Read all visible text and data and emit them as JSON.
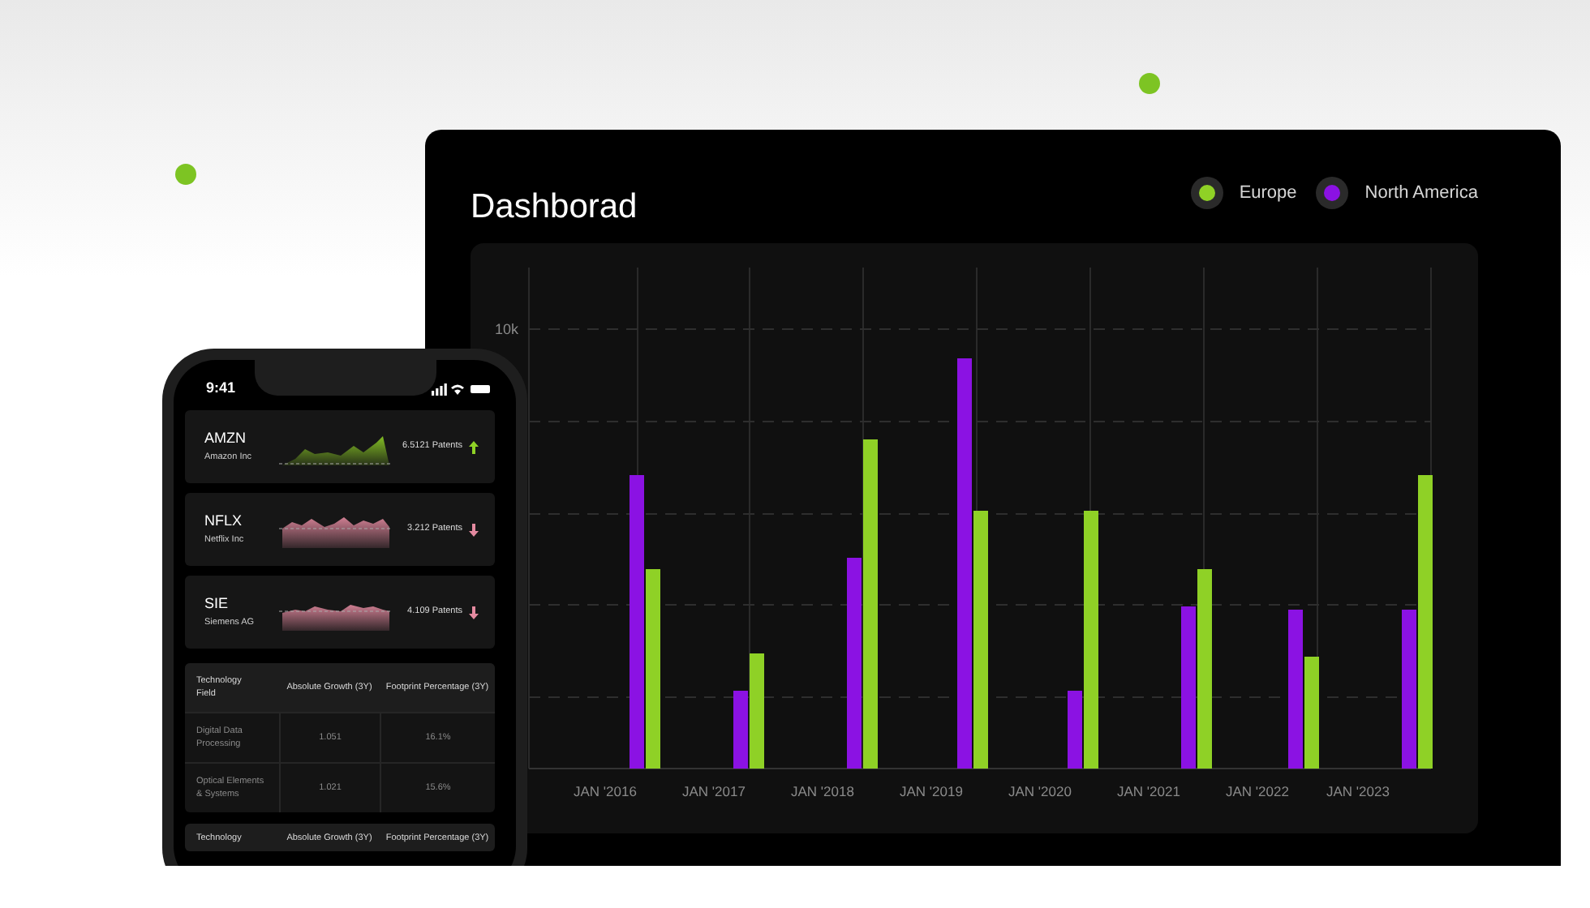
{
  "dashboard": {
    "title": "Dashborad",
    "legend": [
      {
        "label": "Europe",
        "color": "#8fd126"
      },
      {
        "label": "North America",
        "color": "#8b12e3"
      }
    ],
    "chart": {
      "y_tick": "10k",
      "x_labels": [
        "JAN '2016",
        "JAN '2017",
        "JAN '2018",
        "JAN '2019",
        "JAN '2020",
        "JAN '2021",
        "JAN '2022",
        "JAN '2023"
      ]
    }
  },
  "phone": {
    "time": "9:41",
    "stocks": [
      {
        "ticker": "AMZN",
        "name": "Amazon Inc",
        "patents": "6.5121 Patents",
        "rising": true
      },
      {
        "ticker": "NFLX",
        "name": "Netflix Inc",
        "patents": "3.212 Patents",
        "rising": false
      },
      {
        "ticker": "SIE",
        "name": "Siemens AG",
        "patents": "4.109 Patents",
        "rising": false
      }
    ],
    "tables": [
      {
        "columns": [
          "Technology Field",
          "Absolute Growth (3Y)",
          "Footprint Percentage (3Y)"
        ],
        "rows": [
          [
            "Digital Data Processing",
            "1.051",
            "16.1%"
          ],
          [
            "Optical Elements & Systems",
            "1.021",
            "15.6%"
          ]
        ]
      },
      {
        "columns": [
          "Technology",
          "Absolute Growth (3Y)",
          "Footprint Percentage (3Y)"
        ]
      }
    ]
  }
}
